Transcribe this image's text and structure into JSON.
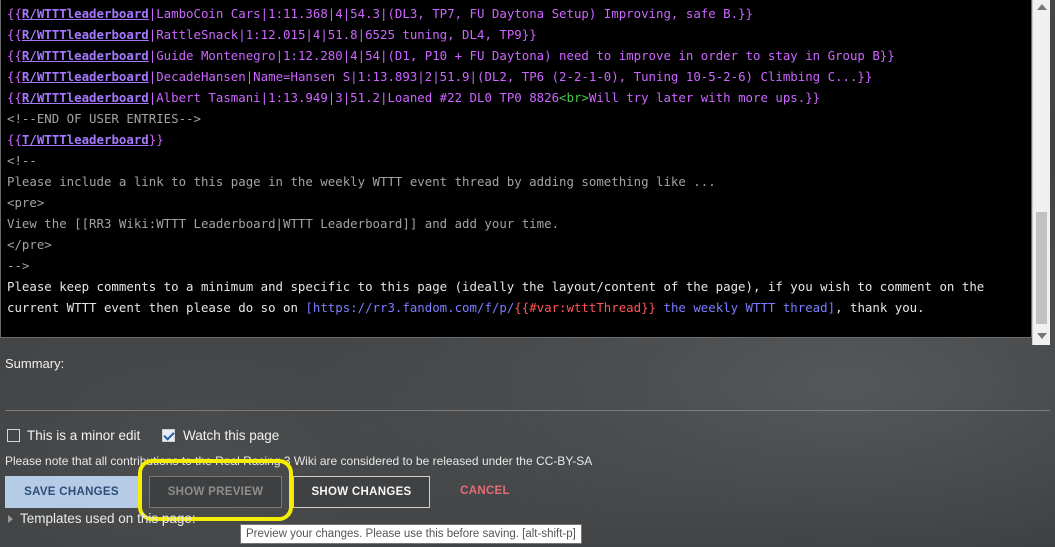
{
  "editor": {
    "lines": [
      [
        {
          "t": "{{",
          "c": "br"
        },
        {
          "t": "R/WTTTleaderboard",
          "c": "tl"
        },
        {
          "t": "|LamboCoin Cars|1:11.368|4|54.3|(DL3, TP7, FU Daytona Setup) Improving, safe B.}}",
          "c": "txt"
        }
      ],
      [
        {
          "t": "{{",
          "c": "br"
        },
        {
          "t": "R/WTTTleaderboard",
          "c": "tl"
        },
        {
          "t": "|RattleSnack|1:12.015|4|51.8|6525 tuning, DL4, TP9}}",
          "c": "txt"
        }
      ],
      [
        {
          "t": "{{",
          "c": "br"
        },
        {
          "t": "R/WTTTleaderboard",
          "c": "tl"
        },
        {
          "t": "|Guide Montenegro|1:12.280|4|54|(D1, P10 + FU Daytona) need to improve in order to stay in Group B}}",
          "c": "txt"
        }
      ],
      [
        {
          "t": "{{",
          "c": "br"
        },
        {
          "t": "R/WTTTleaderboard",
          "c": "tl"
        },
        {
          "t": "|DecadeHansen|Name=Hansen S|1:13.893|2|51.9|(DL2, TP6 (2-2-1-0), Tuning 10-5-2-6) Climbing C...}}",
          "c": "txt"
        }
      ],
      [
        {
          "t": "{{",
          "c": "br"
        },
        {
          "t": "R/WTTTleaderboard",
          "c": "tl"
        },
        {
          "t": "|Albert Tasmani|1:13.949|3|51.2|Loaned #22 DL0 TP0 8826",
          "c": "txt"
        },
        {
          "t": "<br>",
          "c": "tag"
        },
        {
          "t": "Will try later with more ups.}}",
          "c": "txt"
        }
      ],
      [
        {
          "t": "<!--END OF USER ENTRIES-->",
          "c": "cm"
        }
      ],
      [
        {
          "t": "{{",
          "c": "br"
        },
        {
          "t": "T/WTTTleaderboard",
          "c": "tl"
        },
        {
          "t": "}}",
          "c": "br"
        }
      ],
      [
        {
          "t": "<!--",
          "c": "cm"
        }
      ],
      [
        {
          "t": "Please include a link to this page in the weekly WTTT event thread by adding something like ...",
          "c": "cm"
        }
      ],
      [
        {
          "t": "<pre>",
          "c": "cm"
        }
      ],
      [
        {
          "t": "View the [[RR3 Wiki:WTTT Leaderboard|WTTT Leaderboard]] and add your time.",
          "c": "cm"
        }
      ],
      [
        {
          "t": "</pre>",
          "c": "cm"
        }
      ],
      [
        {
          "t": "-->",
          "c": "cm"
        }
      ],
      [
        {
          "t": "Please keep comments to a minimum and specific to this page (ideally the layout/content of the page), if you wish to comment on the",
          "c": "plain"
        }
      ],
      [
        {
          "t": "current WTTT event then please do so on ",
          "c": "plain"
        },
        {
          "t": "[https://rr3.fandom.com/f/p/",
          "c": "lnk"
        },
        {
          "t": "{{#var:wtttThread}}",
          "c": "pf"
        },
        {
          "t": " the weekly WTTT thread]",
          "c": "lnk"
        },
        {
          "t": ", thank you.",
          "c": "plain"
        }
      ]
    ]
  },
  "summary": {
    "label": "Summary:"
  },
  "options": {
    "minor_edit": "This is a minor edit",
    "watch_page": "Watch this page",
    "watch_checked": true,
    "minor_checked": false
  },
  "notice": "Please note that all contributions to the Real Racing 3 Wiki are considered to be released under the CC-BY-SA",
  "buttons": {
    "save": "SAVE CHANGES",
    "preview": "SHOW PREVIEW",
    "changes": "SHOW CHANGES",
    "cancel": "CANCEL"
  },
  "templates": "Templates used on this page:",
  "tooltip": "Preview your changes. Please use this before saving. [alt-shift-p]",
  "colors": {
    "highlight": "#f5ee00",
    "save_bg": "#b5cbe6",
    "cancel": "#e56b78"
  }
}
